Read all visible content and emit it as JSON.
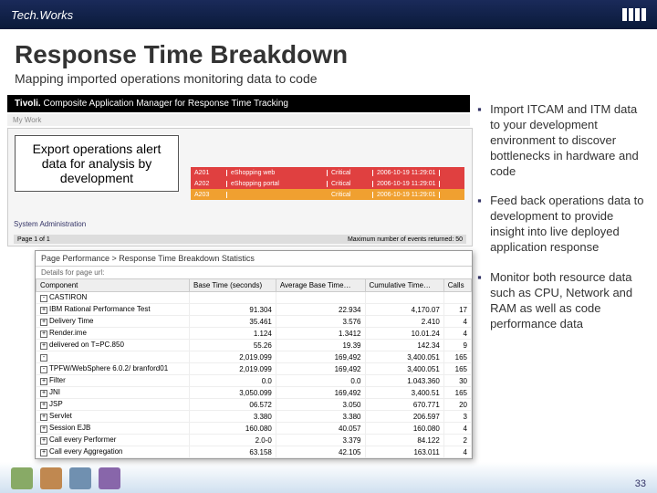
{
  "header": {
    "brand_left": "Tech.",
    "brand_right": "Works",
    "logo": "IBM"
  },
  "title": "Response Time Breakdown",
  "subtitle": "Mapping imported operations monitoring data to code",
  "tivoli": {
    "label": "Tivoli.",
    "app": "Composite Application Manager for Response Time Tracking",
    "menu": "My Work"
  },
  "callout": "Export operations alert data for analysis by development",
  "alerts": {
    "rows": [
      {
        "id": "A201",
        "desc": "eShopping web",
        "sev": "Critical",
        "time": "2006-10-19 11:29:01",
        "cls": "red"
      },
      {
        "id": "A202",
        "desc": "eShopping portal",
        "sev": "Critical",
        "time": "2006-10-19 11:29:01",
        "cls": "red"
      },
      {
        "id": "A203",
        "desc": "",
        "sev": "Critical",
        "time": "2006-10-19 11:29:01",
        "cls": "orange"
      }
    ]
  },
  "sys_admin": "System Administration",
  "page_bar": {
    "left": "Page 1 of 1",
    "right": "Maximum number of events returned: 50"
  },
  "stats": {
    "breadcrumb": "Page Performance > Response Time Breakdown Statistics",
    "filter": "Details for page url:",
    "columns": [
      "Component",
      "Base Time (seconds)",
      "Average Base Time…",
      "Cumulative Time…",
      "Calls"
    ],
    "rows": [
      {
        "indent": 0,
        "exp": "-",
        "name": "CASTIRON",
        "bt": "",
        "abt": "",
        "ct": "",
        "c": ""
      },
      {
        "indent": 1,
        "exp": "+",
        "name": "IBM Rational Performance Test",
        "bt": "91.304",
        "abt": "22.934",
        "ct": "4,170.07",
        "c": "17"
      },
      {
        "indent": 1,
        "exp": "+",
        "name": "Delivery Time",
        "bt": "35.461",
        "abt": "3.576",
        "ct": "2.410",
        "c": "4"
      },
      {
        "indent": 1,
        "exp": "+",
        "name": "Render.ime",
        "bt": "1.124",
        "abt": "1.3412",
        "ct": "10.01.24",
        "c": "4"
      },
      {
        "indent": 1,
        "exp": "+",
        "name": "delivered on T=PC.850",
        "bt": "55.26",
        "abt": "19.39",
        "ct": "142.34",
        "c": "9"
      },
      {
        "indent": 0,
        "exp": "-",
        "name": "",
        "bt": "2,019.099",
        "abt": "169,492",
        "ct": "3,400.051",
        "c": "165"
      },
      {
        "indent": 1,
        "exp": "-",
        "name": "TPFW/WebSphere 6.0.2/ branford01",
        "bt": "2,019.099",
        "abt": "169,492",
        "ct": "3,400.051",
        "c": "165"
      },
      {
        "indent": 2,
        "exp": "+",
        "name": "Filter",
        "bt": "0.0",
        "abt": "0.0",
        "ct": "1.043.360",
        "c": "30"
      },
      {
        "indent": 2,
        "exp": "+",
        "name": "JNI",
        "bt": "3,050.099",
        "abt": "169,492",
        "ct": "3,400.51",
        "c": "165"
      },
      {
        "indent": 2,
        "exp": "+",
        "name": "JSP",
        "bt": "06.572",
        "abt": "3.050",
        "ct": "670.771",
        "c": "20"
      },
      {
        "indent": 2,
        "exp": "+",
        "name": "Servlet",
        "bt": "3.380",
        "abt": "3.380",
        "ct": "206.597",
        "c": "3"
      },
      {
        "indent": 2,
        "exp": "+",
        "name": "Session EJB",
        "bt": "160.080",
        "abt": "40.057",
        "ct": "160.080",
        "c": "4"
      },
      {
        "indent": 2,
        "exp": "+",
        "name": "Call every Performer",
        "bt": "2.0-0",
        "abt": "3.379",
        "ct": "84.122",
        "c": "2"
      },
      {
        "indent": 2,
        "exp": "+",
        "name": "Call every Aggregation",
        "bt": "63.158",
        "abt": "42.105",
        "ct": "163.011",
        "c": "4"
      }
    ]
  },
  "bullets": [
    "Import ITCAM and ITM data to your development environment to discover bottlenecks in hardware and code",
    "Feed back operations data to development to provide insight into live deployed application response",
    "Monitor both resource data such as CPU, Network and RAM as well as code performance data"
  ],
  "page_num": "33"
}
